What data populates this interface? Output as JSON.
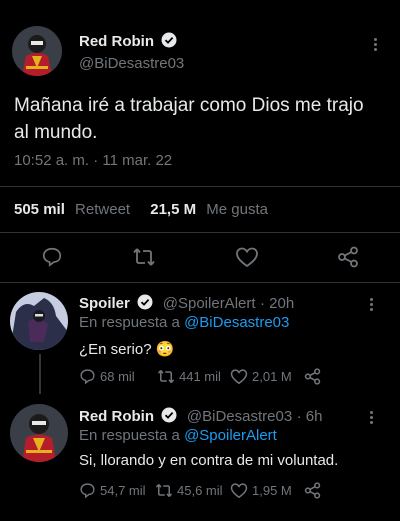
{
  "main_tweet": {
    "display_name": "Red Robin",
    "handle": "@BiDesastre03",
    "text_line1": "Mañana iré a trabajar como Dios me trajo",
    "text_line2": "al mundo.",
    "timestamp": "10:52 a. m. · 11 mar. 22",
    "retweets_count": "505 mil",
    "retweets_label": "Retweet",
    "likes_count": "21,5 M",
    "likes_label": "Me gusta"
  },
  "replies": [
    {
      "display_name": "Spoiler",
      "handle": "@SpoilerAlert",
      "time": "· 20h",
      "reply_prefix": "En respuesta a",
      "reply_to": "@BiDesastre03",
      "text": "¿En serio? 😳",
      "replies": "68 mil",
      "retweets": "441 mil",
      "likes": "2,01 M"
    },
    {
      "display_name": "Red Robin",
      "handle": "@BiDesastre03",
      "time": "· 6h",
      "reply_prefix": "En respuesta a",
      "reply_to": "@SpoilerAlert",
      "text": "Si, llorando y en contra de mi voluntad.",
      "replies": "54,7 mil",
      "retweets": "45,6 mil",
      "likes": "1,95 M"
    }
  ],
  "colors": {
    "accent": "#1d9bf0",
    "muted": "#71767b",
    "divider": "#2f3336"
  }
}
